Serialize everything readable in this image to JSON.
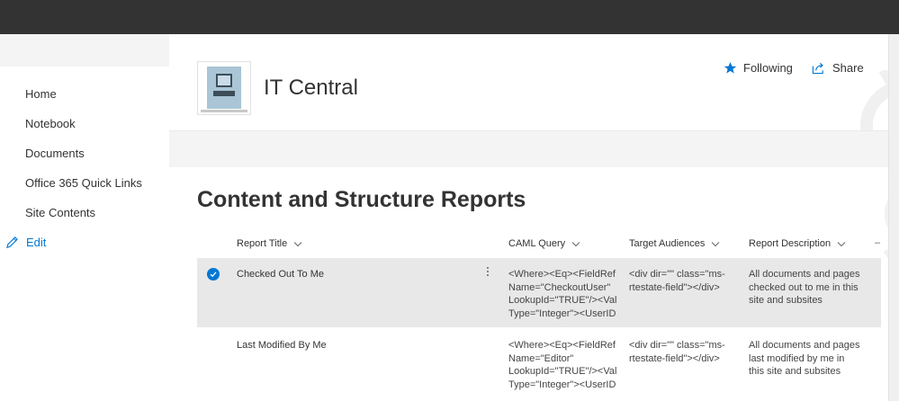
{
  "nav": {
    "items": [
      "Home",
      "Notebook",
      "Documents",
      "Office 365 Quick Links",
      "Site Contents"
    ],
    "edit_label": "Edit"
  },
  "site": {
    "title": "IT Central",
    "following_label": "Following",
    "share_label": "Share"
  },
  "page": {
    "title": "Content and Structure Reports"
  },
  "list": {
    "columns": [
      "Report Title",
      "CAML Query",
      "Target Audiences",
      "Report Description"
    ],
    "rows": [
      {
        "title": "Checked Out To Me",
        "caml": [
          "<Where><Eq><FieldRef",
          "Name=\"CheckoutUser\"",
          "LookupId=\"TRUE\"/><Value",
          "Type=\"Integer\"><UserID"
        ],
        "audiences": "<div dir=\"\" class=\"ms-rtestate-field\"></div>",
        "description": "All documents and pages checked out to me in this site and subsites",
        "selected": true
      },
      {
        "title": "Last Modified By Me",
        "caml": [
          "<Where><Eq><FieldRef",
          "Name=\"Editor\"",
          "LookupId=\"TRUE\"/><Value",
          "Type=\"Integer\"><UserID"
        ],
        "audiences": "<div dir=\"\" class=\"ms-rtestate-field\"></div>",
        "description": "All documents and pages last modified by me in this site and subsites",
        "selected": false
      }
    ]
  },
  "colors": {
    "accent": "#0078d4",
    "suite_bar": "#333333",
    "selected_row": "#e8e8e8"
  },
  "icons": {
    "following": "star-icon",
    "share": "share-icon",
    "edit": "pencil-icon",
    "column_sort": "chevron-down-icon",
    "row_selected": "checkmark-circle-icon",
    "row_actions": "more-vertical-icon"
  }
}
